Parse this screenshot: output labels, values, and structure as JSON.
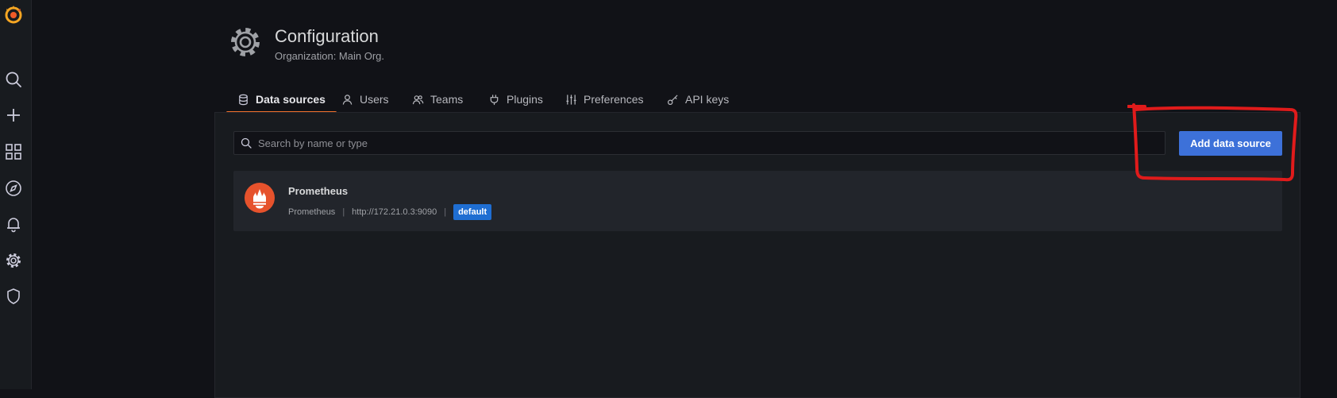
{
  "header": {
    "title": "Configuration",
    "subtitle": "Organization: Main Org."
  },
  "sidebar": {
    "items": [
      {
        "icon": "grafana-logo-icon"
      },
      {
        "icon": "search-icon"
      },
      {
        "icon": "plus-icon"
      },
      {
        "icon": "dashboards-icon"
      },
      {
        "icon": "explore-compass-icon"
      },
      {
        "icon": "alerting-bell-icon"
      },
      {
        "icon": "configuration-gear-icon"
      },
      {
        "icon": "server-admin-shield-icon"
      }
    ]
  },
  "tabs": [
    {
      "label": "Data sources",
      "icon": "database-icon",
      "active": true
    },
    {
      "label": "Users",
      "icon": "user-icon",
      "active": false
    },
    {
      "label": "Teams",
      "icon": "users-icon",
      "active": false
    },
    {
      "label": "Plugins",
      "icon": "plug-icon",
      "active": false
    },
    {
      "label": "Preferences",
      "icon": "sliders-icon",
      "active": false
    },
    {
      "label": "API keys",
      "icon": "key-icon",
      "active": false
    }
  ],
  "search": {
    "placeholder": "Search by name or type",
    "value": ""
  },
  "actions": {
    "add_label": "Add data source"
  },
  "datasources": [
    {
      "name": "Prometheus",
      "type": "Prometheus",
      "url": "http://172.21.0.3:9090",
      "badge": "default",
      "icon": "prometheus-logo-icon"
    }
  ],
  "colors": {
    "accent_tab": "#f0712c",
    "primary_button": "#3d71d9",
    "badge": "#1f6ed2",
    "annotation": "#e01b1b",
    "prometheus": "#e6522c"
  }
}
